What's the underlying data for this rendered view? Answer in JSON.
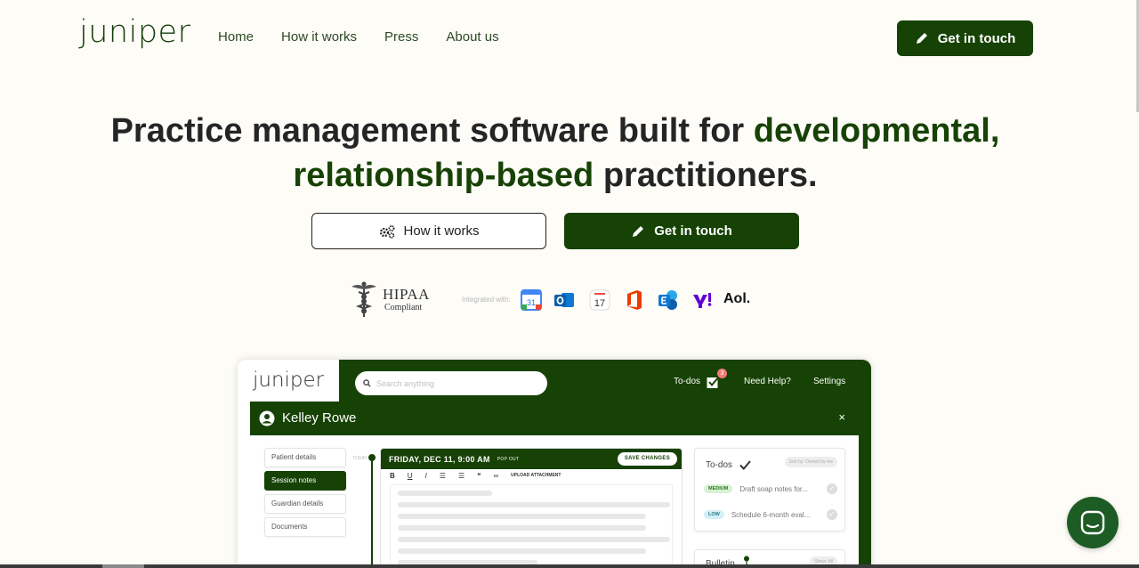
{
  "brand": {
    "logo": "juniper",
    "accent": "#174205",
    "background": "#fdfcf7"
  },
  "nav": {
    "items": [
      "Home",
      "How it works",
      "Press",
      "About us"
    ],
    "cta_label": "Get in touch",
    "cta_icon": "pencil-icon"
  },
  "hero": {
    "title_part1": "Practice management software built for ",
    "title_highlight1": "developmental,",
    "title_highlight2": "relationship-based",
    "title_part2": " practitioners.",
    "secondary_button": "How it works",
    "secondary_icon": "gears-icon",
    "primary_button": "Get in touch"
  },
  "integrations": {
    "hipaa_title": "HIPAA",
    "hipaa_subtitle": "Compliant",
    "label": "Integrated with:",
    "google_calendar_day": "31",
    "apple_calendar_day": "17",
    "aol": "Aol.",
    "icons": [
      "google-calendar-icon",
      "outlook-icon",
      "apple-calendar-icon",
      "office-icon",
      "exchange-icon",
      "yahoo-icon",
      "aol-icon"
    ]
  },
  "mock": {
    "logo": "juniper",
    "search_placeholder": "Search anything",
    "todos_label": "To-dos",
    "todos_badge": "3",
    "help_label": "Need Help?",
    "settings_label": "Settings",
    "patient_name": "Kelley Rowe",
    "close": "×",
    "tabs": [
      "Patient details",
      "Session notes",
      "Guardian details",
      "Documents"
    ],
    "today_label": "TODAY",
    "note_date": "FRIDAY, DEC 11, 9:00 AM",
    "pop_out": "POP OUT",
    "save_changes": "SAVE CHANGES",
    "upload_attachment": "UPLOAD ATTACHMENT",
    "todo_panel_title": "To-dos",
    "sort_label": "Sort by: Owned by me",
    "todo_items": [
      {
        "priority": "MEDIUM",
        "text": "Draft soap notes for..."
      },
      {
        "priority": "LOW",
        "text": "Schedule 6-month eval..."
      }
    ],
    "bulletin_title": "Bulletin",
    "bulletin_filter": "Show: All"
  }
}
